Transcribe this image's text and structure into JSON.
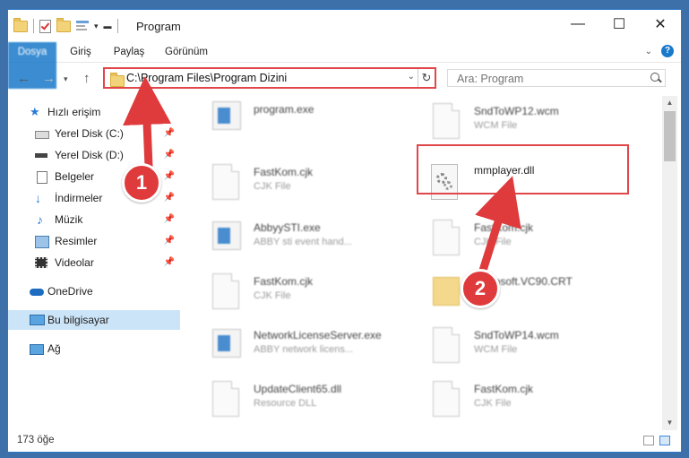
{
  "window": {
    "title": "Program"
  },
  "caption": {
    "minimize": "—",
    "maximize": "☐",
    "close": "✕"
  },
  "ribbon": {
    "tabs": [
      "Dosya",
      "Giriş",
      "Paylaş",
      "Görünüm"
    ]
  },
  "address": {
    "path": "C:\\Program Files\\Program Dizini",
    "search_placeholder": "Ara: Program"
  },
  "nav": {
    "quick_access": "Hızlı erişim",
    "items": [
      {
        "label": "Yerel Disk (C:)"
      },
      {
        "label": "Yerel Disk (D:)"
      },
      {
        "label": "Belgeler"
      },
      {
        "label": "İndirmeler"
      },
      {
        "label": "Müzik"
      },
      {
        "label": "Resimler"
      },
      {
        "label": "Videolar"
      }
    ],
    "onedrive": "OneDrive",
    "this_pc": "Bu bilgisayar",
    "network": "Ağ"
  },
  "files": {
    "left": [
      {
        "name": "program.exe",
        "type": ""
      },
      {
        "name": "FastKom.cjk",
        "type": "CJK File"
      },
      {
        "name": "AbbyySTI.exe",
        "type": "ABBY sti event hand..."
      },
      {
        "name": "FastKom.cjk",
        "type": "CJK File"
      },
      {
        "name": "NetworkLicenseServer.exe",
        "type": "ABBY network licens..."
      },
      {
        "name": "UpdateClient65.dll",
        "type": "Resource DLL"
      }
    ],
    "right": [
      {
        "name": "SndToWP12.wcm",
        "type": "WCM File"
      },
      {
        "name": "mmplayer.dll",
        "type": ""
      },
      {
        "name": "FastKom.cjk",
        "type": "CJK File"
      },
      {
        "name": "Microsoft.VC90.CRT",
        "type": ""
      },
      {
        "name": "SndToWP14.wcm",
        "type": "WCM File"
      },
      {
        "name": "FastKom.cjk",
        "type": "CJK File"
      }
    ]
  },
  "status": {
    "count": "173 öğe"
  },
  "annotations": {
    "step1": "1",
    "step2": "2"
  },
  "colors": {
    "accent": "#1979ca",
    "annotation": "#df3a3c",
    "selected": "#cce4f7"
  }
}
